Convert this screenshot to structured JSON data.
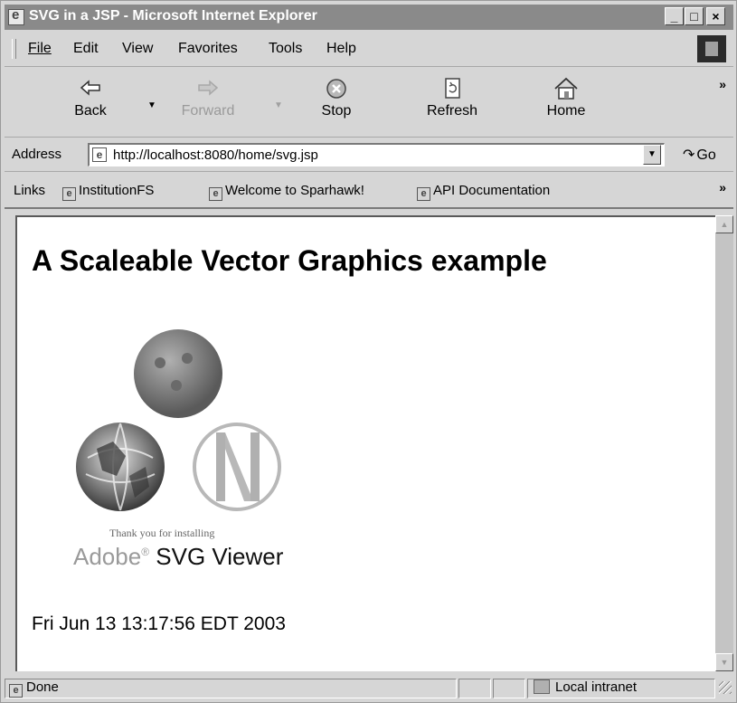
{
  "window": {
    "title": "SVG in a JSP - Microsoft Internet Explorer",
    "controls": {
      "minimize": "_",
      "maximize": "□",
      "close": "×"
    }
  },
  "menubar": {
    "items": [
      {
        "label": "File"
      },
      {
        "label": "Edit"
      },
      {
        "label": "View"
      },
      {
        "label": "Favorites"
      },
      {
        "label": "Tools"
      },
      {
        "label": "Help"
      }
    ]
  },
  "toolbar": {
    "back": {
      "label": "Back",
      "icon": "back-arrow-icon"
    },
    "forward": {
      "label": "Forward",
      "icon": "forward-arrow-icon",
      "enabled": false
    },
    "stop": {
      "label": "Stop",
      "icon": "stop-icon"
    },
    "refresh": {
      "label": "Refresh",
      "icon": "refresh-icon"
    },
    "home": {
      "label": "Home",
      "icon": "home-icon"
    },
    "more": "»"
  },
  "address": {
    "label": "Address",
    "value": "http://localhost:8080/home/svg.jsp",
    "go_label": "Go"
  },
  "links": {
    "label": "Links",
    "items": [
      {
        "label": "InstitutionFS"
      },
      {
        "label": "Welcome to Sparhawk!"
      },
      {
        "label": "API Documentation"
      }
    ],
    "more": "»"
  },
  "page": {
    "heading": "A Scaleable Vector Graphics example",
    "svg_caption": "Thank you for installing",
    "svg_brand": "Adobe",
    "svg_product": "SVG Viewer",
    "timestamp": "Fri Jun 13 13:17:56 EDT 2003"
  },
  "status": {
    "text": "Done",
    "zone": "Local intranet"
  }
}
